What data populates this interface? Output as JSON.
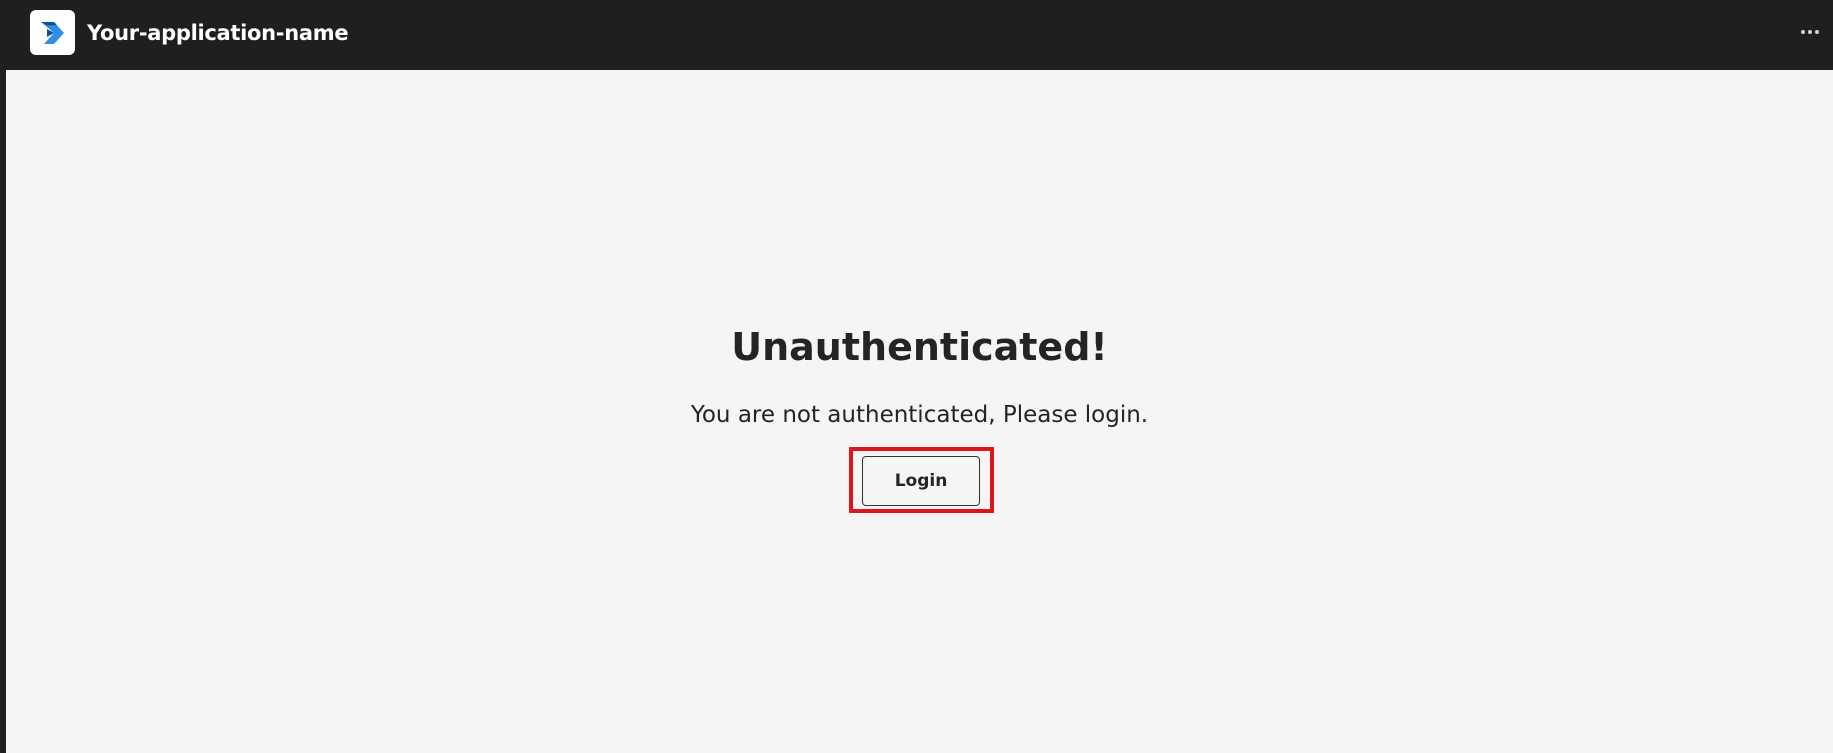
{
  "app": {
    "title": "Your-application-name",
    "logo_icon": "app-arrow-logo",
    "more_icon": "more-horizontal-icon"
  },
  "main": {
    "heading": "Unauthenticated!",
    "message": "You are not authenticated, Please login.",
    "login_label": "Login"
  },
  "colors": {
    "titlebar_bg": "#1f1f1f",
    "content_bg": "#f5f5f5",
    "highlight": "#e0141b",
    "logo_blue_dark": "#0f4f9e",
    "logo_blue_light": "#2f8ee5"
  }
}
